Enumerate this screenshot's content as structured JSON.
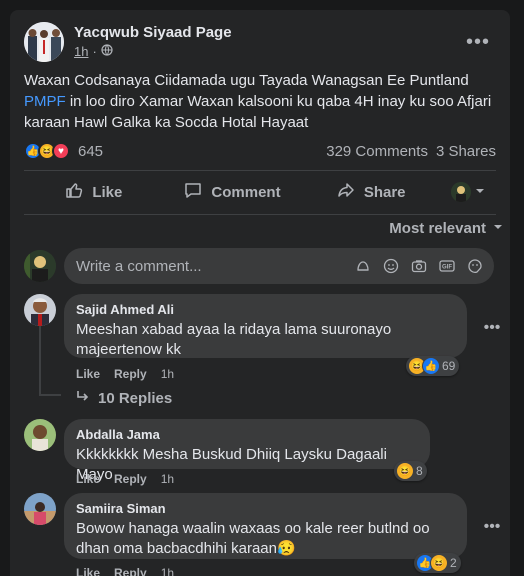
{
  "post": {
    "author": "Yacqwub Siyaad Page",
    "time": "1h",
    "text_before": "Waxan Codsanaya Ciidamada ugu Tayada Wanagsan Ee Puntland ",
    "text_link": "PMPF",
    "text_after": " in loo diro Xamar Waxan kalsooni ku qaba 4H inay ku soo Afjari karaan Hawl Galka ka Socda Hotal Hayaat",
    "reaction_count": "645",
    "comments_count": "329 Comments",
    "shares_count": "3 Shares"
  },
  "actions": {
    "like": "Like",
    "comment": "Comment",
    "share": "Share"
  },
  "sort_label": "Most relevant",
  "composer_placeholder": "Write a comment...",
  "comments": [
    {
      "name": "Sajid Ahmed Ali",
      "text": "Meeshan xabad ayaa la ridaya lama suuronayo majeertenow kk",
      "like": "Like",
      "reply": "Reply",
      "time": "1h",
      "reactions": "69"
    },
    {
      "name": "Abdalla Jama",
      "text": "Kkkkkkkk Mesha Buskud Dhiiq Laysku Dagaali Mayo",
      "like": "Like",
      "reply": "Reply",
      "time": "1h",
      "reactions": "8"
    },
    {
      "name": "Samiira Siman",
      "text": "Bowow hanaga waalin waxaas oo kale reer butlnd oo dhan oma bacbacdhihi karaan😥",
      "like": "Like",
      "reply": "Reply",
      "time": "1h",
      "reactions": "2"
    }
  ],
  "replies_label": "10 Replies",
  "colors": {
    "background": "#18191a",
    "card": "#242526",
    "bubble": "#3a3b3c",
    "link": "#4599ff",
    "like_blue": "#1877f2",
    "haha_yellow": "#f7b125",
    "love_red": "#f33e58"
  }
}
